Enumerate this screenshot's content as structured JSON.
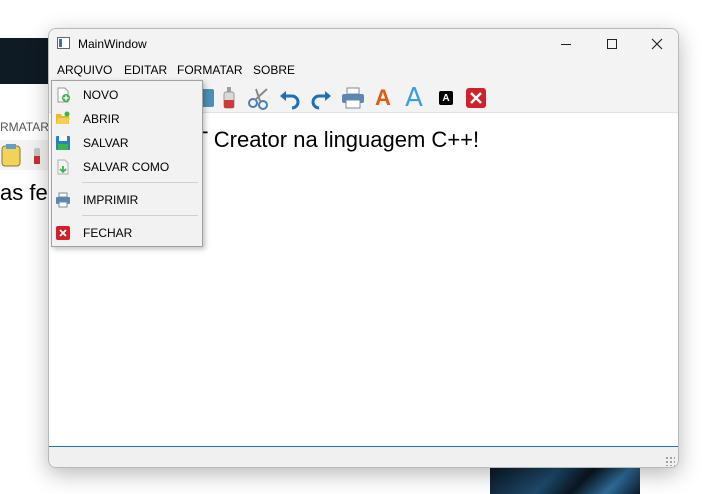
{
  "background": {
    "menu_fragment": "RMATAR",
    "text_fragment": "as fe"
  },
  "window": {
    "title": "MainWindow",
    "controls": {
      "minimize_icon": "minimize-icon",
      "maximize_icon": "maximize-icon",
      "close_icon": "close-icon"
    }
  },
  "menubar": {
    "items": [
      "ARQUIVO",
      "EDITAR",
      "FORMATAR",
      "SOBRE"
    ]
  },
  "toolbar": {
    "icons": [
      "paste-icon",
      "glue-icon",
      "cut-icon",
      "undo-icon",
      "redo-icon",
      "print-icon",
      "font-color-icon",
      "font-size-icon",
      "font-style-icon",
      "close-icon"
    ],
    "font_color_glyph": "A",
    "font_size_glyph": "A",
    "font_style_glyph": "A"
  },
  "editor": {
    "text": "s feito com QT Creator na linguagem C++!"
  },
  "arquivo_menu": {
    "items": [
      {
        "label": "NOVO",
        "icon": "new-file-icon"
      },
      {
        "label": "ABRIR",
        "icon": "folder-open-icon"
      },
      {
        "label": "SALVAR",
        "icon": "save-icon"
      },
      {
        "label": "SALVAR COMO",
        "icon": "save-as-icon"
      },
      {
        "label": "IMPRIMIR",
        "icon": "print-icon"
      },
      {
        "label": "FECHAR",
        "icon": "close-icon"
      }
    ]
  },
  "colors": {
    "accent_blue": "#1f6fb4",
    "close_red": "#d0202a",
    "font_orange": "#e05a12"
  }
}
